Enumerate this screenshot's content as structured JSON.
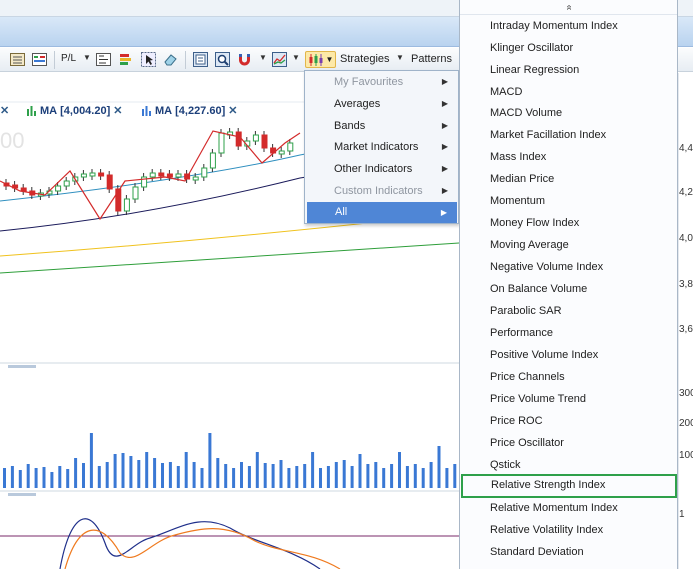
{
  "toolbar": {
    "pl_label": "P/L",
    "strategies_label": "Strategies",
    "patterns_label": "Patterns"
  },
  "legend": [
    {
      "label": "MA",
      "value": "[4,004.20]"
    },
    {
      "label": "MA",
      "value": "[4,227.60]"
    }
  ],
  "background_value": "00",
  "axis_labels": [
    "4,4",
    "4,2",
    "4,0",
    "3,8",
    "3,6",
    "300",
    "200",
    "100",
    "1"
  ],
  "indicator_menu": {
    "items": [
      {
        "label": "My Favourites",
        "disabled": true
      },
      {
        "label": "Averages",
        "disabled": false
      },
      {
        "label": "Bands",
        "disabled": false
      },
      {
        "label": "Market Indicators",
        "disabled": false
      },
      {
        "label": "Other Indicators",
        "disabled": false
      },
      {
        "label": "Custom Indicators",
        "disabled": true
      },
      {
        "label": "All",
        "disabled": false,
        "selected": true
      }
    ]
  },
  "all_indicators": {
    "scroll_up_symbol": "»",
    "items": [
      "Intraday Momentum Index",
      "Klinger Oscillator",
      "Linear Regression",
      "MACD",
      "MACD Volume",
      "Market Facillation Index",
      "Mass Index",
      "Median Price",
      "Momentum",
      "Money Flow Index",
      "Moving Average",
      "Negative Volume Index",
      "On Balance Volume",
      "Parabolic SAR",
      "Performance",
      "Positive Volume Index",
      "Price Channels",
      "Price Volume Trend",
      "Price ROC",
      "Price Oscillator",
      "Qstick",
      "Relative Strength Index",
      "Relative Momentum Index",
      "Relative Volatility Index",
      "Standard Deviation"
    ],
    "highlighted": "Relative Strength Index"
  },
  "colors": {
    "accent": "#4f86d6",
    "highlight_border": "#2ea04a",
    "bull": "#2ea04a",
    "bear": "#d32b2b",
    "volume": "#3a78d4"
  }
}
